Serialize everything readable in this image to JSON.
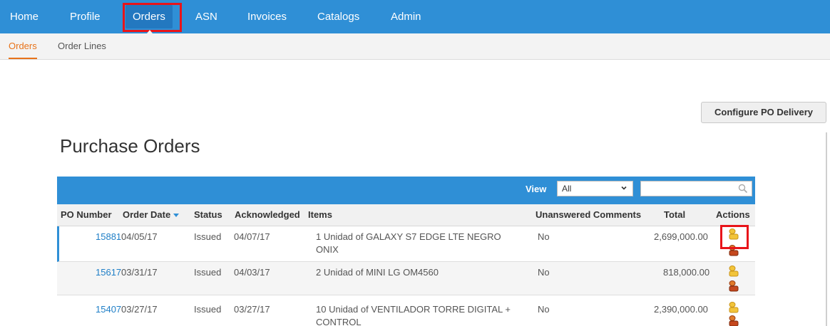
{
  "topnav": {
    "items": [
      {
        "label": "Home"
      },
      {
        "label": "Profile"
      },
      {
        "label": "Orders"
      },
      {
        "label": "ASN"
      },
      {
        "label": "Invoices"
      },
      {
        "label": "Catalogs"
      },
      {
        "label": "Admin"
      }
    ],
    "active": "Orders"
  },
  "subnav": {
    "items": [
      {
        "label": "Orders"
      },
      {
        "label": "Order Lines"
      }
    ],
    "active": "Orders"
  },
  "configure_button": "Configure PO Delivery",
  "page_title": "Purchase Orders",
  "toolbar": {
    "view_label": "View",
    "view_value": "All",
    "search_placeholder": ""
  },
  "table": {
    "columns": [
      "PO Number",
      "Order Date",
      "Status",
      "Acknowledged",
      "Items",
      "Unanswered Comments",
      "Total",
      "Actions"
    ],
    "sorted_column": "Order Date",
    "rows": [
      {
        "po": "15881",
        "date": "04/05/17",
        "status": "Issued",
        "ack": "04/07/17",
        "items": "1 Unidad of GALAXY S7 EDGE LTE NEGRO ONIX",
        "comments": "No",
        "total": "2,699,000.00"
      },
      {
        "po": "15617",
        "date": "03/31/17",
        "status": "Issued",
        "ack": "04/03/17",
        "items": "2 Unidad of MINI LG OM4560",
        "comments": "No",
        "total": "818,000.00"
      },
      {
        "po": "15407",
        "date": "03/27/17",
        "status": "Issued",
        "ack": "03/27/17",
        "items": "10 Unidad of VENTILADOR TORRE DIGITAL + CONTROL",
        "comments": "No",
        "total": "2,390,000.00"
      }
    ]
  },
  "colors": {
    "nav_blue": "#2f8fd6",
    "active_orange": "#e8731a",
    "highlight_red": "#e8141a",
    "link_blue": "#1f7fc7"
  },
  "icons": [
    "chevron-down-icon",
    "search-icon",
    "create-invoice-icon",
    "create-credit-memo-icon"
  ]
}
